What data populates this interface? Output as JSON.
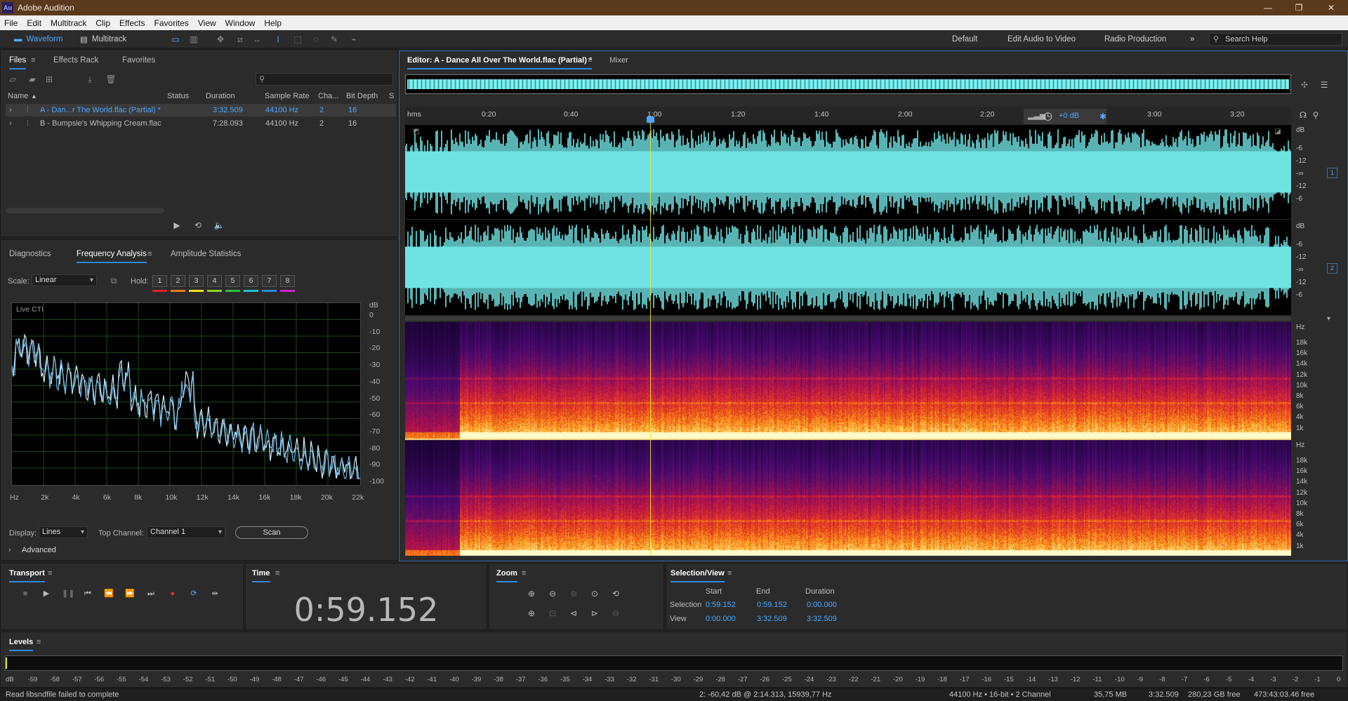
{
  "app": {
    "title": "Adobe Audition",
    "logo": "Au"
  },
  "menu": [
    "File",
    "Edit",
    "Multitrack",
    "Clip",
    "Effects",
    "Favorites",
    "View",
    "Window",
    "Help"
  ],
  "toolbar": {
    "waveform": "Waveform",
    "multitrack": "Multitrack",
    "workspaces": [
      "Default",
      "Edit Audio to Video",
      "Radio Production"
    ],
    "search_help": "Search Help"
  },
  "files_panel": {
    "tabs": [
      "Files",
      "Effects Rack",
      "Favorites"
    ],
    "columns": [
      "Name",
      "Status",
      "Duration",
      "Sample Rate",
      "Cha...",
      "Bit Depth",
      "S"
    ],
    "rows": [
      {
        "name": "A - Dan...r The World.flac (Partial) *",
        "duration": "3:32.509",
        "rate": "44100 Hz",
        "ch": "2",
        "bits": "16"
      },
      {
        "name": "B - Bumpsie's Whipping Cream.flac",
        "duration": "7:28.093",
        "rate": "44100 Hz",
        "ch": "2",
        "bits": "16"
      }
    ]
  },
  "freq_panel": {
    "tabs": [
      "Diagnostics",
      "Frequency Analysis",
      "Amplitude Statistics"
    ],
    "scale_label": "Scale:",
    "scale_value": "Linear",
    "hold_label": "Hold:",
    "hold": [
      "1",
      "2",
      "3",
      "4",
      "5",
      "6",
      "7",
      "8"
    ],
    "hold_colors": [
      "#e0202a",
      "#f07a1a",
      "#f0e01a",
      "#8ad020",
      "#30c040",
      "#20c0d0",
      "#2a8ae0",
      "#d020d0"
    ],
    "live_label": "Live CTI",
    "db_unit": "dB",
    "db_ticks": [
      "0",
      "-10",
      "-20",
      "-30",
      "-40",
      "-50",
      "-60",
      "-70",
      "-80",
      "-90",
      "-100"
    ],
    "hz_ticks": [
      "Hz",
      "2k",
      "4k",
      "6k",
      "8k",
      "10k",
      "12k",
      "14k",
      "16k",
      "18k",
      "20k",
      "22k"
    ],
    "display_label": "Display:",
    "display_value": "Lines",
    "top_channel_label": "Top Channel:",
    "top_channel_value": "Channel 1",
    "scan": "Scan",
    "advanced": "Advanced"
  },
  "editor": {
    "tab": "Editor: A - Dance All Over The World.flac (Partial) *",
    "mixer": "Mixer",
    "ruler": [
      "hms",
      "0:20",
      "0:40",
      "1:00",
      "1:20",
      "1:40",
      "2:00",
      "2:20",
      "3:00",
      "3:20"
    ],
    "gain": "+0 dB",
    "db_unit": "dB",
    "wave_db": [
      "-6",
      "-12",
      "-∞",
      "-12",
      "-6"
    ],
    "channels": [
      "1",
      "2"
    ],
    "hz_unit": "Hz",
    "spec_hz": [
      "18k",
      "16k",
      "14k",
      "12k",
      "10k",
      "8k",
      "6k",
      "4k",
      "1k"
    ]
  },
  "transport": {
    "title": "Transport"
  },
  "time": {
    "title": "Time",
    "value": "0:59.152"
  },
  "zoom": {
    "title": "Zoom"
  },
  "selection": {
    "title": "Selection/View",
    "headers": [
      "Start",
      "End",
      "Duration"
    ],
    "selection_label": "Selection",
    "selection": [
      "0:59.152",
      "0:59.152",
      "0:00.000"
    ],
    "view_label": "View",
    "view": [
      "0:00.000",
      "3:32.509",
      "3:32.509"
    ]
  },
  "levels": {
    "title": "Levels",
    "ticks": [
      "dB",
      "-59",
      "-58",
      "-57",
      "-56",
      "-55",
      "-54",
      "-53",
      "-52",
      "-51",
      "-50",
      "-49",
      "-48",
      "-47",
      "-46",
      "-45",
      "-44",
      "-43",
      "-42",
      "-41",
      "-40",
      "-39",
      "-38",
      "-37",
      "-36",
      "-35",
      "-34",
      "-33",
      "-32",
      "-31",
      "-30",
      "-29",
      "-28",
      "-27",
      "-26",
      "-25",
      "-24",
      "-23",
      "-22",
      "-21",
      "-20",
      "-19",
      "-18",
      "-17",
      "-16",
      "-15",
      "-14",
      "-13",
      "-12",
      "-11",
      "-10",
      "-9",
      "-8",
      "-7",
      "-6",
      "-5",
      "-4",
      "-3",
      "-2",
      "-1",
      "0"
    ]
  },
  "status": {
    "left": "Read libsndfile failed to complete",
    "cursor": "2: -60,42 dB @ 2:14.313, 15939,77 Hz",
    "format": "44100 Hz • 16-bit • 2 Channel",
    "size": "35,75 MB",
    "duration": "3:32.509",
    "free": "280,23 GB free",
    "free_time": "473:43:03.46 free"
  },
  "colors": {
    "accent": "#2d89e5",
    "waveform": "#6fe2e2",
    "cti": "#e6e63c"
  }
}
